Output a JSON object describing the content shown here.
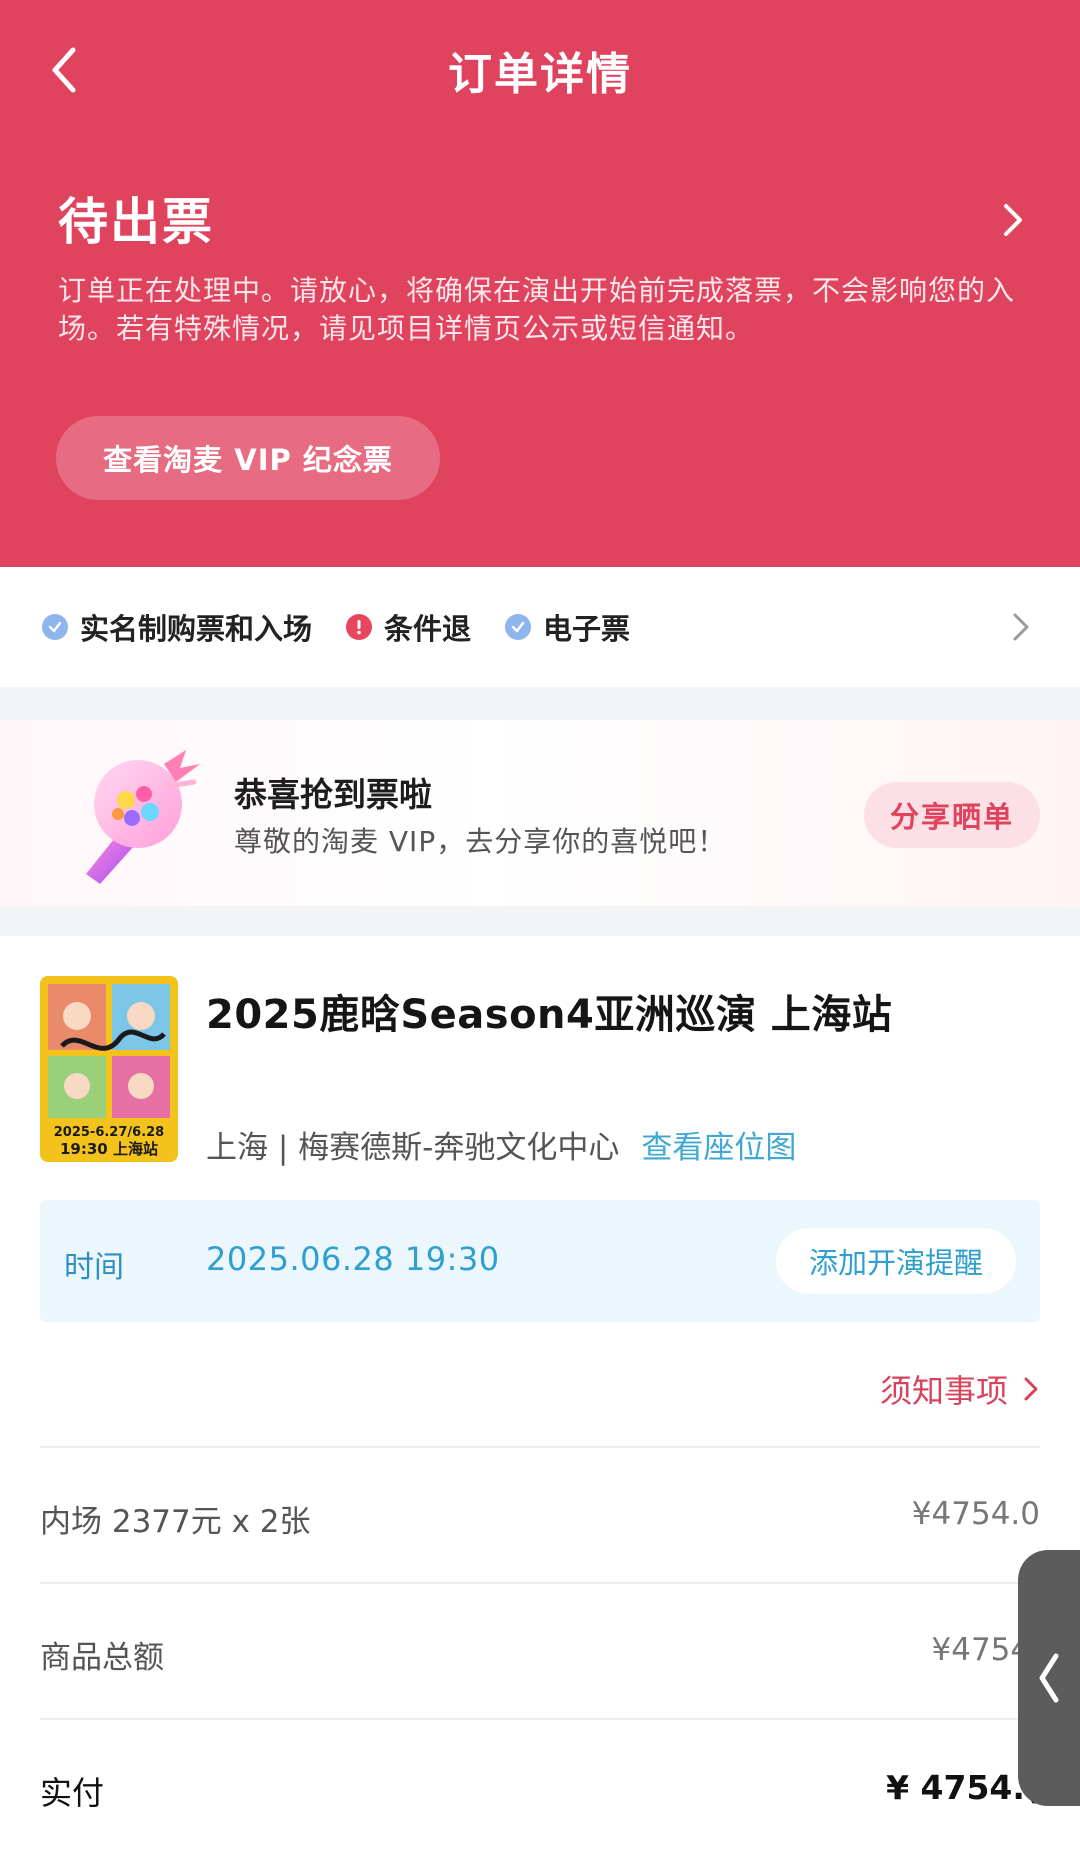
{
  "nav": {
    "title": "订单详情"
  },
  "status": {
    "title": "待出票",
    "description": "订单正在处理中。请放心，将确保在演出开始前完成落票，不会影响您的入场。若有特殊情况，请见项目详情页公示或短信通知。",
    "vip_button": "查看淘麦 VIP 纪念票"
  },
  "tags": [
    {
      "label": "实名制购票和入场",
      "icon": "check-badge-icon",
      "color": "#8fb5ee"
    },
    {
      "label": "条件退",
      "icon": "alert-badge-icon",
      "color": "#e8465f"
    },
    {
      "label": "电子票",
      "icon": "check-badge-icon",
      "color": "#8fb5ee"
    }
  ],
  "banner": {
    "title": "恭喜抢到票啦",
    "subtitle": "尊敬的淘麦 VIP，去分享你的喜悦吧！",
    "share_button": "分享晒单"
  },
  "event": {
    "title": "2025鹿晗Season4亚洲巡演 上海站",
    "venue": "上海 | 梅赛德斯-奔驰文化中心",
    "seat_map_link": "查看座位图",
    "poster": {
      "dates": "2025-6.27/6.28",
      "line2": "19:30 上海站"
    }
  },
  "time": {
    "label": "时间",
    "value": "2025.06.28 19:30",
    "remind_button": "添加开演提醒"
  },
  "notice_link": "须知事项",
  "price_rows": [
    {
      "label": "内场 2377元 x 2张",
      "value": "¥4754.0"
    },
    {
      "label": "商品总额",
      "value": "¥4754."
    },
    {
      "label": "实付",
      "value": "¥ 4754.("
    }
  ],
  "colors": {
    "brand_red": "#e0435e",
    "link_blue": "#41a8d4",
    "notice_red": "#d8435c"
  }
}
